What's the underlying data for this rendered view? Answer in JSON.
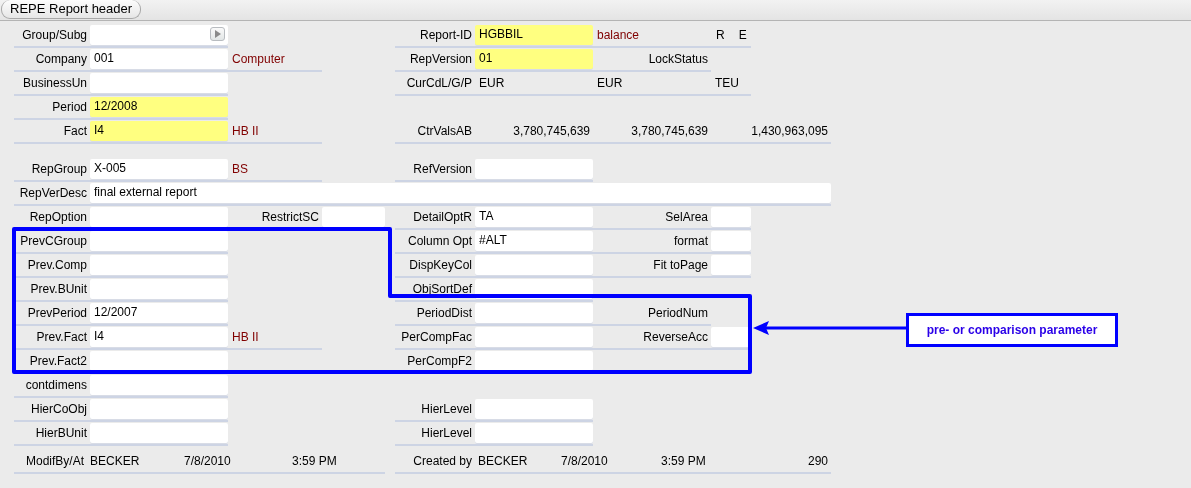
{
  "header_tab": {
    "label": "REPE Report header"
  },
  "rows": [
    {
      "groups": [
        {
          "cells": [
            {
              "kind": "label",
              "text": "Group/Subg"
            },
            {
              "kind": "field",
              "required": false,
              "picker": true
            }
          ]
        },
        {
          "cells": [
            {
              "kind": "label",
              "text": "Report-ID"
            },
            {
              "kind": "field",
              "value": "HGBBIL",
              "required": true
            },
            {
              "kind": "note",
              "text": "balance"
            },
            {
              "kind": "flags",
              "items": [
                "R",
                "E"
              ]
            }
          ]
        }
      ]
    },
    {
      "groups": [
        {
          "cells": [
            {
              "kind": "label",
              "text": "Company"
            },
            {
              "kind": "field",
              "value": "001",
              "required": false
            },
            {
              "kind": "note",
              "text": "Computer"
            }
          ]
        },
        {
          "cells": [
            {
              "kind": "label",
              "text": "RepVersion"
            },
            {
              "kind": "field",
              "value": "01",
              "required": true
            }
          ]
        },
        {
          "cells": [
            {
              "kind": "label",
              "text": "LockStatus"
            }
          ]
        }
      ]
    },
    {
      "groups": [
        {
          "cells": [
            {
              "kind": "label",
              "text": "BusinessUn"
            },
            {
              "kind": "field",
              "required": false
            }
          ]
        },
        {
          "cells": [
            {
              "kind": "label",
              "text": "CurCdL/G/P"
            },
            {
              "kind": "text",
              "text": "EUR"
            },
            {
              "kind": "text",
              "text": "EUR"
            },
            {
              "kind": "text",
              "text": "TEU"
            }
          ]
        }
      ]
    },
    {
      "groups": [
        {
          "cells": [
            {
              "kind": "label",
              "text": "Period"
            },
            {
              "kind": "field",
              "value": "12/2008",
              "required": true
            }
          ]
        }
      ]
    },
    {
      "groups": [
        {
          "cells": [
            {
              "kind": "label",
              "text": "Fact"
            },
            {
              "kind": "field",
              "value": "I4",
              "required": true
            },
            {
              "kind": "note",
              "text": "HB II"
            }
          ]
        },
        {
          "cells": [
            {
              "kind": "label",
              "text": "CtrValsAB"
            },
            {
              "kind": "number",
              "text": "3,780,745,639"
            },
            {
              "kind": "number",
              "text": "3,780,745,639"
            },
            {
              "kind": "number",
              "text": "1,430,963,095"
            }
          ]
        }
      ]
    },
    {
      "groups": [
        {
          "cells": [
            {
              "kind": "label",
              "text": "RepGroup"
            },
            {
              "kind": "field",
              "value": "X-005",
              "required": false
            },
            {
              "kind": "note",
              "text": "BS"
            }
          ]
        },
        {
          "cells": [
            {
              "kind": "label",
              "text": "RefVersion"
            },
            {
              "kind": "field",
              "required": false
            }
          ]
        }
      ]
    },
    {
      "groups": [
        {
          "cells": [
            {
              "kind": "label",
              "text": "RepVerDesc"
            },
            {
              "kind": "field",
              "value": "final external report",
              "required": false
            }
          ]
        }
      ]
    },
    {
      "groups": [
        {
          "cells": [
            {
              "kind": "label",
              "text": "RepOption"
            },
            {
              "kind": "field",
              "required": false
            }
          ]
        },
        {
          "cells": [
            {
              "kind": "label",
              "text": "RestrictSC"
            },
            {
              "kind": "field",
              "required": false
            }
          ]
        },
        {
          "cells": [
            {
              "kind": "label",
              "text": "DetailOptR"
            },
            {
              "kind": "field",
              "value": "TA",
              "required": false
            }
          ]
        },
        {
          "cells": [
            {
              "kind": "label",
              "text": "SelArea"
            },
            {
              "kind": "field",
              "required": false
            }
          ]
        }
      ]
    },
    {
      "groups": [
        {
          "cells": [
            {
              "kind": "label",
              "text": "PrevCGroup"
            },
            {
              "kind": "field",
              "required": false
            }
          ]
        },
        {
          "cells": [
            {
              "kind": "label",
              "text": "Column Opt"
            },
            {
              "kind": "field",
              "value": "#ALT",
              "required": false
            }
          ]
        },
        {
          "cells": [
            {
              "kind": "label",
              "text": "format"
            },
            {
              "kind": "field",
              "required": false
            }
          ]
        }
      ]
    },
    {
      "groups": [
        {
          "cells": [
            {
              "kind": "label",
              "text": "Prev.Comp"
            },
            {
              "kind": "field",
              "required": false
            }
          ]
        },
        {
          "cells": [
            {
              "kind": "label",
              "text": "DispKeyCol"
            },
            {
              "kind": "field",
              "required": false
            }
          ]
        },
        {
          "cells": [
            {
              "kind": "label",
              "text": "Fit toPage"
            },
            {
              "kind": "field",
              "required": false
            }
          ]
        }
      ]
    },
    {
      "groups": [
        {
          "cells": [
            {
              "kind": "label",
              "text": "Prev.BUnit"
            },
            {
              "kind": "field",
              "required": false
            }
          ]
        },
        {
          "cells": [
            {
              "kind": "label",
              "text": "ObjSortDef"
            },
            {
              "kind": "field",
              "required": false
            }
          ]
        }
      ]
    },
    {
      "groups": [
        {
          "cells": [
            {
              "kind": "label",
              "text": "PrevPeriod"
            },
            {
              "kind": "field",
              "value": "12/2007",
              "required": false
            }
          ]
        },
        {
          "cells": [
            {
              "kind": "label",
              "text": "PeriodDist"
            },
            {
              "kind": "field",
              "required": false
            }
          ]
        },
        {
          "cells": [
            {
              "kind": "label",
              "text": "PeriodNum"
            }
          ]
        }
      ]
    },
    {
      "groups": [
        {
          "cells": [
            {
              "kind": "label",
              "text": "Prev.Fact"
            },
            {
              "kind": "field",
              "value": "I4",
              "required": false
            },
            {
              "kind": "note",
              "text": "HB II"
            }
          ]
        },
        {
          "cells": [
            {
              "kind": "label",
              "text": "PerCompFac"
            },
            {
              "kind": "field",
              "required": false
            }
          ]
        },
        {
          "cells": [
            {
              "kind": "label",
              "text": "ReverseAcc"
            },
            {
              "kind": "field",
              "required": false
            }
          ]
        }
      ]
    },
    {
      "groups": [
        {
          "cells": [
            {
              "kind": "label",
              "text": "Prev.Fact2"
            },
            {
              "kind": "field",
              "required": false
            }
          ]
        },
        {
          "cells": [
            {
              "kind": "label",
              "text": "PerCompF2"
            },
            {
              "kind": "field",
              "required": false
            }
          ]
        }
      ]
    },
    {
      "groups": [
        {
          "cells": [
            {
              "kind": "label",
              "text": "contdimens"
            },
            {
              "kind": "field",
              "required": false
            }
          ]
        }
      ]
    },
    {
      "groups": [
        {
          "cells": [
            {
              "kind": "label",
              "text": "HierCoObj"
            },
            {
              "kind": "field",
              "required": false
            }
          ]
        },
        {
          "cells": [
            {
              "kind": "label",
              "text": "HierLevel"
            },
            {
              "kind": "field",
              "required": false
            }
          ]
        }
      ]
    },
    {
      "groups": [
        {
          "cells": [
            {
              "kind": "label",
              "text": "HierBUnit"
            },
            {
              "kind": "field",
              "required": false
            }
          ]
        },
        {
          "cells": [
            {
              "kind": "label",
              "text": "HierLevel"
            },
            {
              "kind": "field",
              "required": false
            }
          ]
        }
      ]
    },
    {
      "groups": [
        {
          "cells": [
            {
              "kind": "label",
              "text": "ModifBy/At"
            },
            {
              "kind": "text",
              "text": "BECKER"
            },
            {
              "kind": "text",
              "text": "7/8/2010"
            },
            {
              "kind": "text",
              "text": "3:59 PM"
            }
          ]
        },
        {
          "cells": [
            {
              "kind": "label",
              "text": "Created by"
            },
            {
              "kind": "text",
              "text": "BECKER"
            },
            {
              "kind": "text",
              "text": "7/8/2010"
            },
            {
              "kind": "text",
              "text": "3:59 PM"
            },
            {
              "kind": "number",
              "text": "290"
            }
          ]
        }
      ]
    }
  ],
  "annotation": {
    "text": "pre- or comparison parameter"
  }
}
